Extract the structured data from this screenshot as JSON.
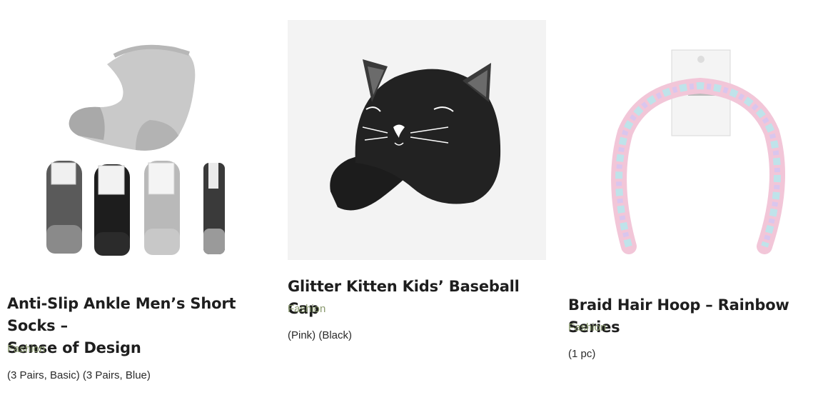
{
  "products": [
    {
      "title": "Anti-Slip Ankle Men’s Short Socks – Sense of Design",
      "title_line1": "Anti-Slip Ankle Men’s Short Socks –",
      "title_line2": "Sense of Design",
      "category": "Fashion",
      "variants": "(3 Pairs, Basic) (3 Pairs, Blue)",
      "image_icon": "socks-image"
    },
    {
      "title": "Glitter Kitten Kids’ Baseball Cap",
      "category": "Fashion",
      "variants": "(Pink) (Black)",
      "image_icon": "cat-cap-image"
    },
    {
      "title": "Braid Hair Hoop – Rainbow Series",
      "category": "Fashion",
      "variants": "(1 pc)",
      "image_icon": "hair-hoop-image"
    }
  ],
  "colors": {
    "category": "#8a9a6f",
    "title": "#1e1e1e",
    "image_bg": "#f3f3f3"
  }
}
